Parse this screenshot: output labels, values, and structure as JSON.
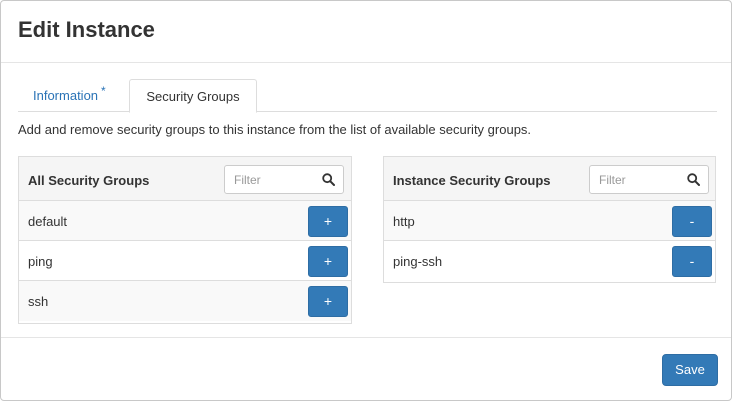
{
  "modal": {
    "title": "Edit Instance"
  },
  "tabs": [
    {
      "label": "Information",
      "required_marker": "*",
      "active": false
    },
    {
      "label": "Security Groups",
      "active": true
    }
  ],
  "help_text": "Add and remove security groups to this instance from the list of available security groups.",
  "all_groups": {
    "title": "All Security Groups",
    "filter_placeholder": "Filter",
    "filter_value": "",
    "items": [
      {
        "name": "default",
        "action": "+"
      },
      {
        "name": "ping",
        "action": "+"
      },
      {
        "name": "ssh",
        "action": "+"
      }
    ]
  },
  "instance_groups": {
    "title": "Instance Security Groups",
    "filter_placeholder": "Filter",
    "filter_value": "",
    "items": [
      {
        "name": "http",
        "action": "-"
      },
      {
        "name": "ping-ssh",
        "action": "-"
      }
    ]
  },
  "footer": {
    "save_label": "Save"
  },
  "colors": {
    "primary": "#337ab7",
    "link": "#2a73b6"
  },
  "icons": {
    "filter": "search-icon"
  }
}
